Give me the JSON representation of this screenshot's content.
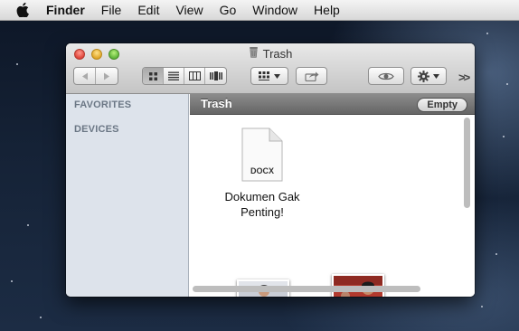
{
  "menubar": {
    "app_name": "Finder",
    "items": [
      "File",
      "Edit",
      "View",
      "Go",
      "Window",
      "Help"
    ]
  },
  "window": {
    "title": "Trash",
    "view_mode_selected": "icon"
  },
  "sidebar": {
    "sections": [
      "FAVORITES",
      "DEVICES"
    ]
  },
  "pathbar": {
    "title": "Trash",
    "empty_label": "Empty"
  },
  "files": [
    {
      "type": "document",
      "ext_label": "DOCX",
      "name_line1": "Dokumen Gak",
      "name_line2": "Penting!"
    },
    {
      "type": "image"
    },
    {
      "type": "image"
    }
  ]
}
